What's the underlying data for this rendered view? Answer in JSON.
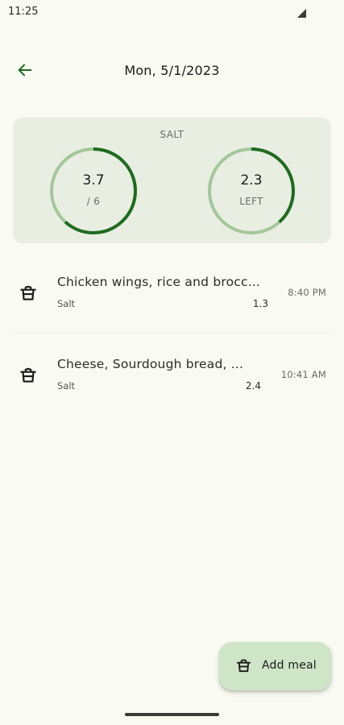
{
  "status_bar": {
    "time": "11:25"
  },
  "header": {
    "title": "Mon, 5/1/2023",
    "back_icon": "arrow-left-icon"
  },
  "summary": {
    "nutrient_label": "SALT",
    "consumed": {
      "value": "3.7",
      "sub": "/ 6",
      "progress_fraction": 0.617
    },
    "remaining": {
      "value": "2.3",
      "sub": "LEFT",
      "progress_fraction": 0.383
    }
  },
  "meals": [
    {
      "name": "Chicken wings, rice and brocc...",
      "nutrient": "Salt",
      "amount": "1.3",
      "time": "8:40 PM",
      "icon": "meal-pot-icon"
    },
    {
      "name": "Cheese, Sourdough bread, ...",
      "nutrient": "Salt",
      "amount": "2.4",
      "time": "10:41 AM",
      "icon": "meal-pot-icon"
    }
  ],
  "fab": {
    "label": "Add meal",
    "icon": "meal-pot-icon"
  },
  "colors": {
    "background": "#f9faf2",
    "accent": "#1f6b1f",
    "ring_track": "#a3c79a",
    "card": "#e9eee3",
    "fab": "#cfe5c7"
  }
}
